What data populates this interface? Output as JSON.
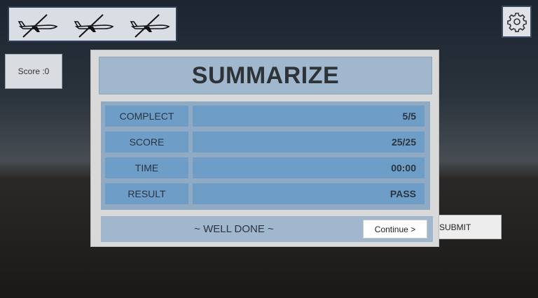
{
  "lives": {
    "count": 3,
    "icon": "crossed-plane-icon"
  },
  "settings": {
    "icon": "gear-icon"
  },
  "score_box": {
    "label": "Score :0"
  },
  "submit": {
    "label": "SUBMIT"
  },
  "dialog": {
    "title": "SUMMARIZE",
    "rows": [
      {
        "label": "COMPLECT",
        "value": "5/5"
      },
      {
        "label": "SCORE",
        "value": "25/25"
      },
      {
        "label": "TIME",
        "value": "00:00"
      },
      {
        "label": "RESULT",
        "value": "PASS"
      }
    ],
    "message": "~ WELL DONE ~",
    "continue_label": "Continue >"
  }
}
